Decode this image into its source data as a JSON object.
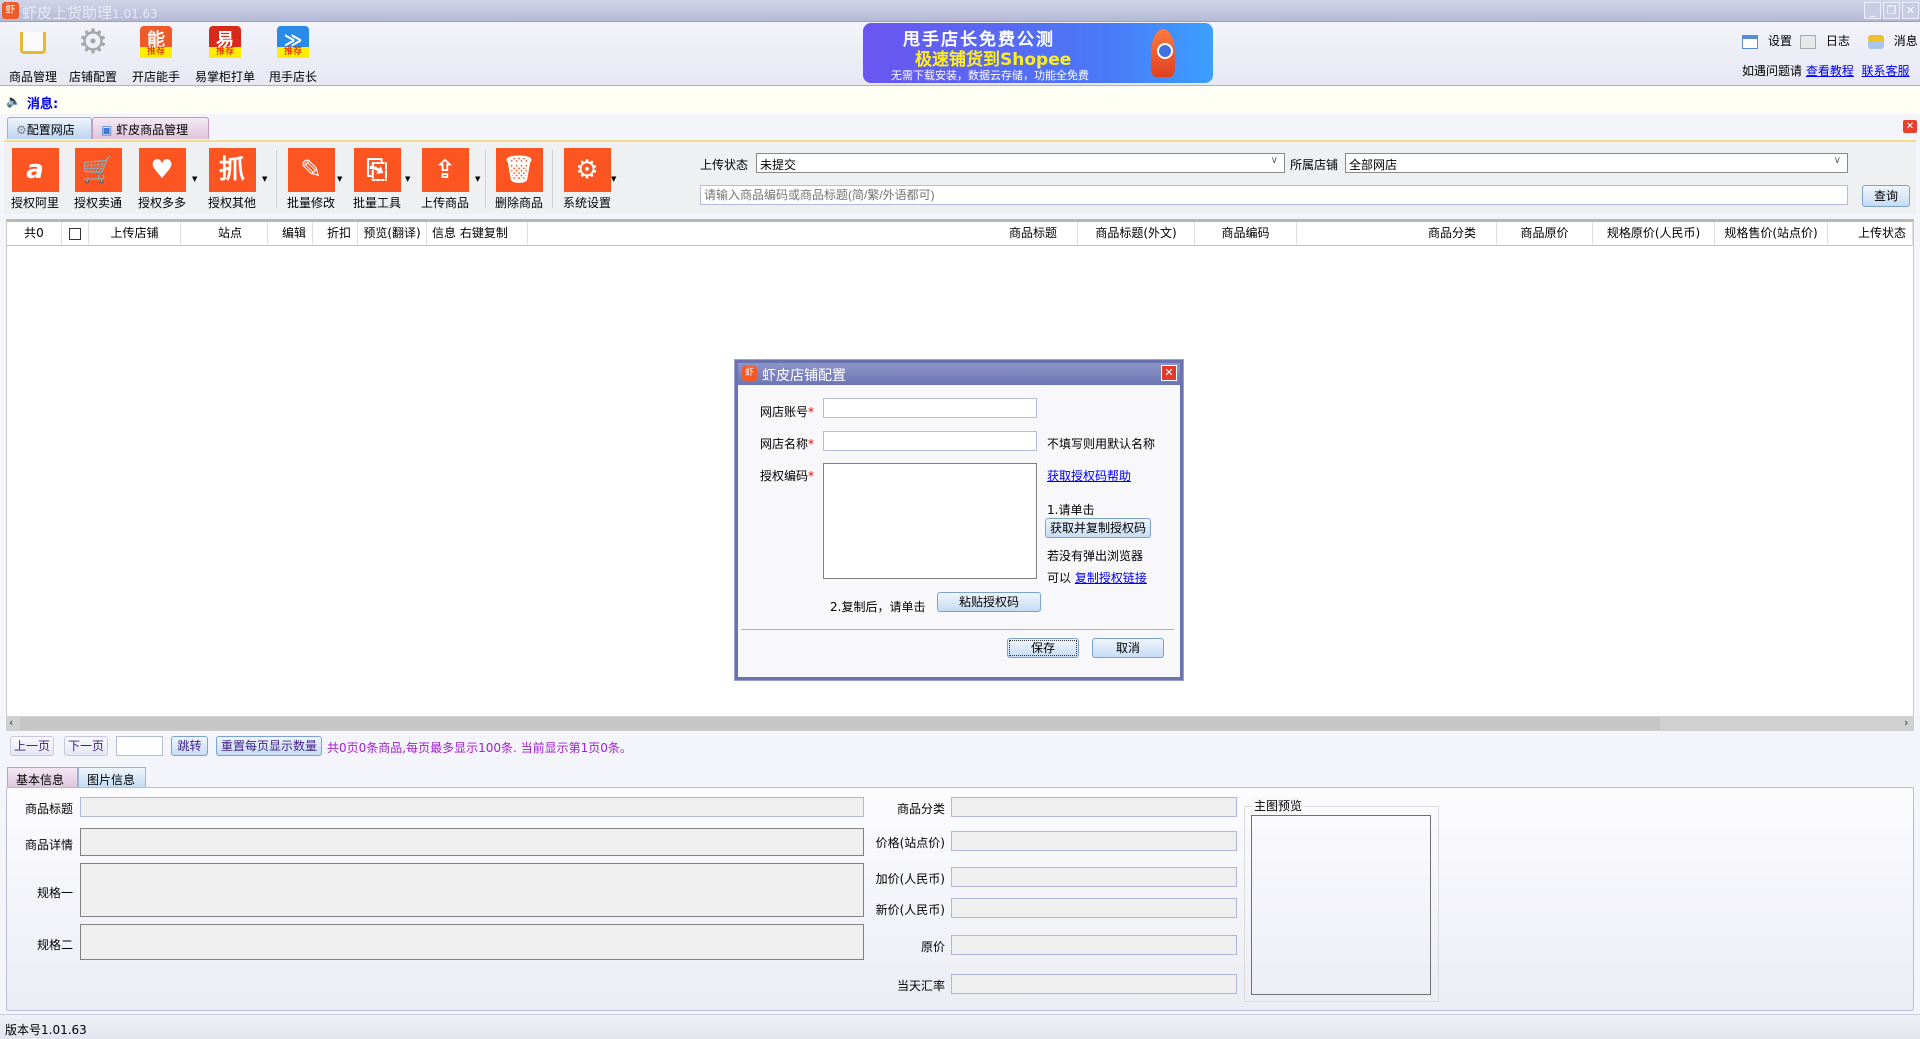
{
  "app": {
    "logo_text": "虾",
    "title": "虾皮上货助理",
    "version": "1.01.63"
  },
  "window_controls": {
    "minimize": "_",
    "restore": "❐",
    "close": "✕"
  },
  "top_toolbar": [
    {
      "label": "商品管理",
      "icon": "cart-icon",
      "color": "#f0c040"
    },
    {
      "label": "店铺配置",
      "icon": "gear-icon",
      "color": "#b0b0b0"
    },
    {
      "label": "开店能手",
      "icon": "shop-bag-icon",
      "glyph": "能",
      "badge": "推荐",
      "color": "#f05a28"
    },
    {
      "label": "易掌柜打单",
      "icon": "yi-icon",
      "glyph": "易",
      "badge": "推荐",
      "color": "#d82a1a"
    },
    {
      "label": "甩手店长",
      "icon": "shuaishou-icon",
      "glyph": "≫",
      "badge": "推荐",
      "color": "#2a8ae8"
    }
  ],
  "banner": {
    "line1": "甩手店长免费公测",
    "line2": "极速铺货到Shopee",
    "line3": "无需下载安装，数据云存储，功能全免费"
  },
  "top_right": {
    "settings": "设置",
    "log": "日志",
    "messages": "消息",
    "help_prefix": "如遇问题请",
    "tutorial_link": "查看教程",
    "support_link": "联系客服"
  },
  "message_bar": {
    "label": "消息:"
  },
  "tabs": [
    {
      "label": "配置网店",
      "active": false
    },
    {
      "label": "虾皮商品管理",
      "active": true
    }
  ],
  "actions": [
    {
      "label": "授权阿里",
      "glyph": "a",
      "dropdown": false
    },
    {
      "label": "授权卖通",
      "glyph": "🛒",
      "dropdown": false
    },
    {
      "label": "授权多多",
      "glyph": "♥",
      "dropdown": true
    },
    {
      "label": "授权其他",
      "glyph": "抓",
      "dropdown": true
    },
    {
      "label": "批量修改",
      "glyph": "✎",
      "dropdown": true
    },
    {
      "label": "批量工具",
      "glyph": "⎘",
      "dropdown": true
    },
    {
      "label": "上传商品",
      "glyph": "⇪",
      "dropdown": true
    },
    {
      "label": "删除商品",
      "glyph": "🗑",
      "dropdown": false
    },
    {
      "label": "系统设置",
      "glyph": "⚙",
      "dropdown": true
    }
  ],
  "filters": {
    "upload_status_label": "上传状态",
    "upload_status_value": "未提交",
    "store_label": "所属店铺",
    "store_value": "全部网店",
    "search_placeholder": "请输入商品编码或商品标题(简/繁/外语都可)",
    "query_button": "查询"
  },
  "grid": {
    "columns": [
      "共0",
      "",
      "上传店铺",
      "站点",
      "编辑",
      "折扣",
      "预览(翻译)",
      "信息 右键复制",
      "商品标题",
      "商品标题(外文)",
      "商品编码",
      "商品分类",
      "商品原价",
      "规格原价(人民币)",
      "规格售价(站点价)",
      "上传状态"
    ],
    "rows": []
  },
  "pager": {
    "prev": "上一页",
    "next": "下一页",
    "page_input": "",
    "jump": "跳转",
    "reset": "重置每页显示数量",
    "summary": "共0页0条商品,每页最多显示100条. 当前显示第1页0条。"
  },
  "detail_tabs": [
    {
      "label": "基本信息",
      "active": true
    },
    {
      "label": "图片信息",
      "active": false
    }
  ],
  "details": {
    "title": "商品标题",
    "detail": "商品详情",
    "spec1": "规格一",
    "spec2": "规格二",
    "category": "商品分类",
    "price_site": "价格(站点价)",
    "markup_rmb": "加价(人民币)",
    "new_price_rmb": "新价(人民币)",
    "original_price": "原价",
    "exchange_rate": "当天汇率",
    "preview": "主图预览"
  },
  "status_bar": {
    "text": "版本号1.01.63"
  },
  "dialog": {
    "title": "虾皮店铺配置",
    "account_label": "网店账号",
    "name_label": "网店名称",
    "name_hint": "不填写则用默认名称",
    "code_label": "授权编码",
    "required": "*",
    "help_link": "获取授权码帮助",
    "step1": "1.请单击",
    "get_copy_button": "获取并复制授权码",
    "no_browser": "若没有弹出浏览器",
    "can_prefix": "可以",
    "copy_link": "复制授权链接",
    "step2": "2.复制后，请单击",
    "paste_button": "粘贴授权码",
    "save": "保存",
    "cancel": "取消",
    "account_value": "",
    "name_value": "",
    "code_value": ""
  }
}
